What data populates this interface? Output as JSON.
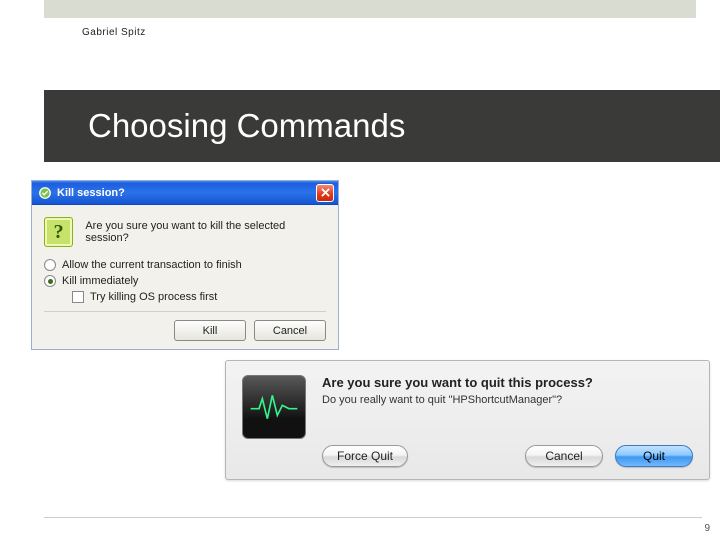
{
  "author": "Gabriel Spitz",
  "slide_title": "Choosing Commands",
  "page_number": "9",
  "xp_dialog": {
    "title": "Kill session?",
    "message": "Are you sure you want to kill the selected session?",
    "options": {
      "allow_finish": "Allow the current transaction to finish",
      "kill_immediately": "Kill immediately"
    },
    "checkbox_label": "Try killing OS process first",
    "buttons": {
      "kill": "Kill",
      "cancel": "Cancel"
    }
  },
  "mac_dialog": {
    "title": "Are you sure you want to quit this process?",
    "subtitle": "Do you really want to quit \"HPShortcutManager\"?",
    "buttons": {
      "force_quit": "Force Quit",
      "cancel": "Cancel",
      "quit": "Quit"
    }
  }
}
